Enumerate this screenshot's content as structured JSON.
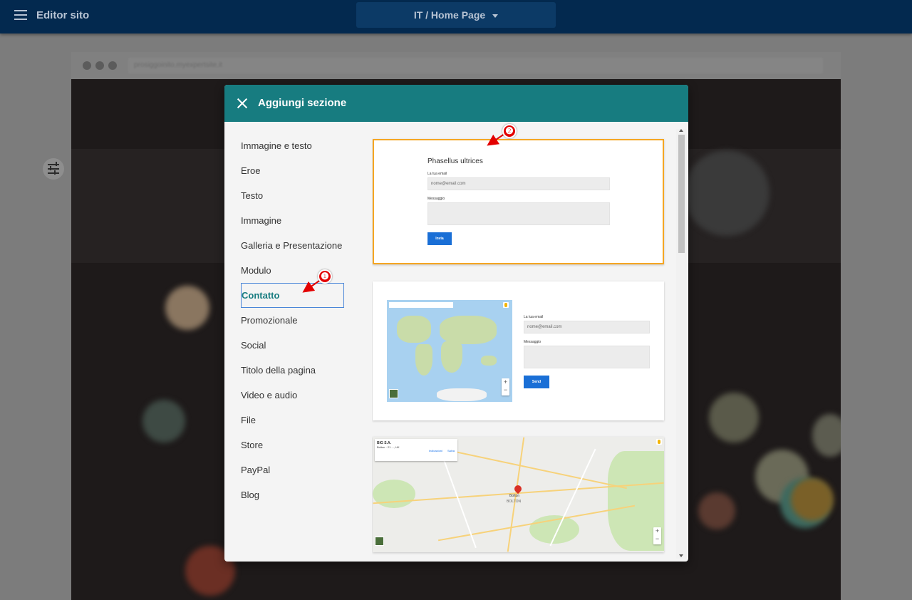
{
  "topbar": {
    "app_title": "Editor sito",
    "page_selector": "IT / Home Page"
  },
  "editor": {
    "url": "prosiggoinito.myexpertsite.it"
  },
  "modal": {
    "title": "Aggiungi sezione",
    "categories": [
      {
        "label": "Immagine e testo"
      },
      {
        "label": "Eroe"
      },
      {
        "label": "Testo"
      },
      {
        "label": "Immagine"
      },
      {
        "label": "Galleria e Presentazione"
      },
      {
        "label": "Modulo"
      },
      {
        "label": "Contatto",
        "active": true
      },
      {
        "label": "Promozionale"
      },
      {
        "label": "Social"
      },
      {
        "label": "Titolo della pagina"
      },
      {
        "label": "Video e audio"
      },
      {
        "label": "File"
      },
      {
        "label": "Store"
      },
      {
        "label": "PayPal"
      },
      {
        "label": "Blog"
      }
    ],
    "previews": {
      "contact_form": {
        "title": "Phasellus ultrices",
        "email_label": "La tua email",
        "email_placeholder": "nome@email.com",
        "message_label": "Messaggio",
        "button": "Invia"
      },
      "map_form": {
        "email_label": "La tua email",
        "email_placeholder": "nome@email.com",
        "message_label": "Messaggio",
        "button": "Send"
      },
      "city_map": {
        "place_name": "BIG S.A.",
        "place_address": "Bolton · 21 ..., UK",
        "directions": "Indicazioni",
        "save": "Salva",
        "city": "Bolton",
        "district": "BOLTON"
      }
    }
  },
  "annotations": {
    "step1": "❶",
    "step2": "❷"
  },
  "colors": {
    "topbar": "#03294f",
    "modal_header": "#177c80",
    "selected_outline": "#f5a623",
    "active_border": "#4a86d8",
    "button_blue": "#1a6fd6",
    "annotation_red": "#e30000"
  }
}
